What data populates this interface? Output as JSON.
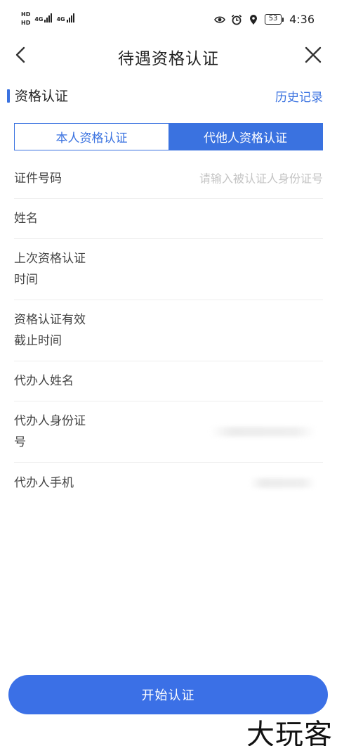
{
  "status_bar": {
    "sim1_tag": "HD",
    "sim2_tag": "HD",
    "network1": "4G",
    "network2": "4G",
    "battery": "53",
    "time": "4:36"
  },
  "header": {
    "title": "待遇资格认证",
    "back_icon": "chevron-left-icon",
    "close_icon": "close-icon"
  },
  "section": {
    "title": "资格认证",
    "history_link": "历史记录",
    "accent_color": "#3a72e0"
  },
  "tabs": [
    {
      "label": "本人资格认证",
      "active": false
    },
    {
      "label": "代他人资格认证",
      "active": true
    }
  ],
  "form": {
    "fields": [
      {
        "label": "证件号码",
        "value": "",
        "placeholder": "请输入被认证人身份证号"
      },
      {
        "label": "姓名",
        "value": ""
      },
      {
        "label": "上次资格认证时间",
        "value": ""
      },
      {
        "label": "资格认证有效截止时间",
        "value": ""
      },
      {
        "label": "代办人姓名",
        "value": ""
      },
      {
        "label": "代办人身份证号",
        "value": ""
      },
      {
        "label": "代办人手机",
        "value": ""
      }
    ]
  },
  "start_button": {
    "label": "开始认证",
    "color": "#3b70e6"
  },
  "watermark": {
    "text": "大玩客"
  }
}
